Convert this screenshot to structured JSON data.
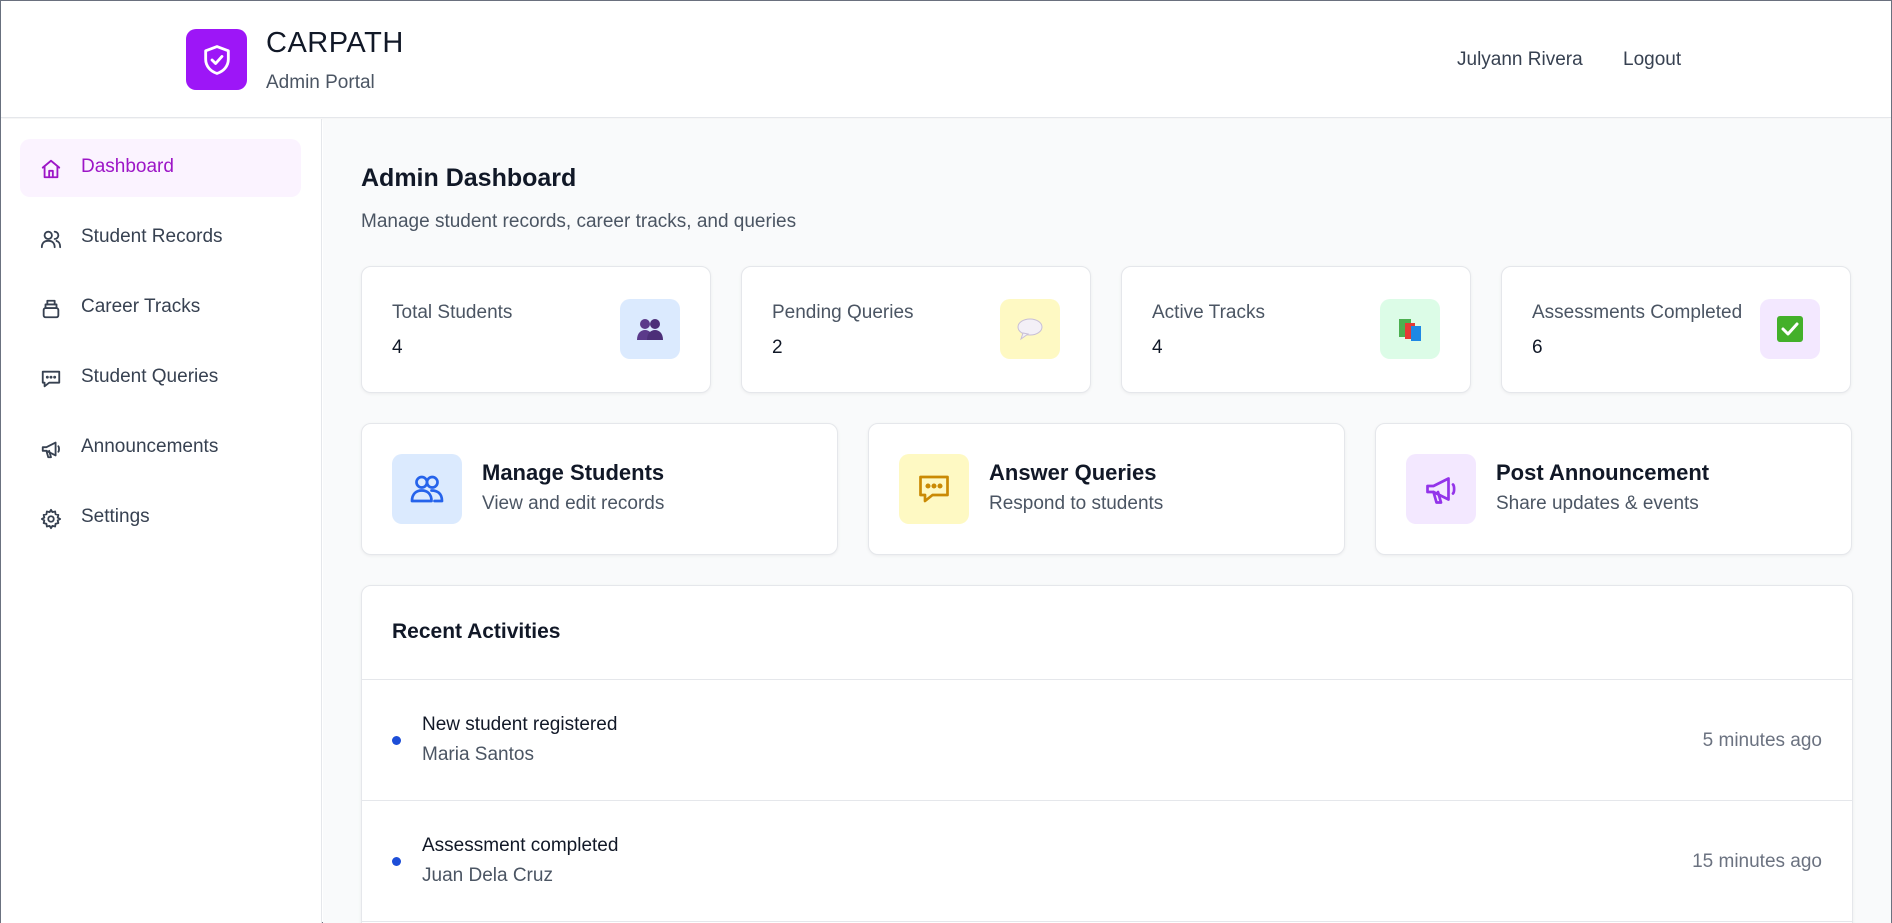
{
  "header": {
    "brand": "CARPATH",
    "subtitle": "Admin Portal",
    "user_name": "Julyann Rivera",
    "logout_label": "Logout",
    "accent": "#9d16f7"
  },
  "sidebar": {
    "items": [
      {
        "label": "Dashboard",
        "icon": "home-icon",
        "active": true
      },
      {
        "label": "Student Records",
        "icon": "users-icon",
        "active": false
      },
      {
        "label": "Career Tracks",
        "icon": "layers-icon",
        "active": false
      },
      {
        "label": "Student Queries",
        "icon": "message-icon",
        "active": false
      },
      {
        "label": "Announcements",
        "icon": "megaphone-icon",
        "active": false
      },
      {
        "label": "Settings",
        "icon": "gear-icon",
        "active": false
      }
    ]
  },
  "main": {
    "title": "Admin Dashboard",
    "subtitle": "Manage student records, career tracks, and queries",
    "stats": [
      {
        "label": "Total Students",
        "value": "4",
        "icon": "people-emoji-icon",
        "bg": "#dbeafe"
      },
      {
        "label": "Pending Queries",
        "value": "2",
        "icon": "speech-bubble-emoji-icon",
        "bg": "#fef9c3"
      },
      {
        "label": "Active Tracks",
        "value": "4",
        "icon": "books-emoji-icon",
        "bg": "#dcfce7"
      },
      {
        "label": "Assessments Completed",
        "value": "6",
        "icon": "check-box-emoji-icon",
        "bg": "#f3e8ff"
      }
    ],
    "actions": [
      {
        "title": "Manage Students",
        "subtitle": "View and edit records",
        "icon": "users-icon",
        "bg": "#dbeafe",
        "color": "#2563eb"
      },
      {
        "title": "Answer Queries",
        "subtitle": "Respond to students",
        "icon": "message-dots-icon",
        "bg": "#fef9c3",
        "color": "#ca8a04"
      },
      {
        "title": "Post Announcement",
        "subtitle": "Share updates & events",
        "icon": "megaphone-icon",
        "bg": "#f3e8ff",
        "color": "#9333ea"
      }
    ],
    "activities": {
      "title": "Recent Activities",
      "items": [
        {
          "event": "New student registered",
          "name": "Maria Santos",
          "time": "5 minutes ago"
        },
        {
          "event": "Assessment completed",
          "name": "Juan Dela Cruz",
          "time": "15 minutes ago"
        }
      ]
    }
  }
}
